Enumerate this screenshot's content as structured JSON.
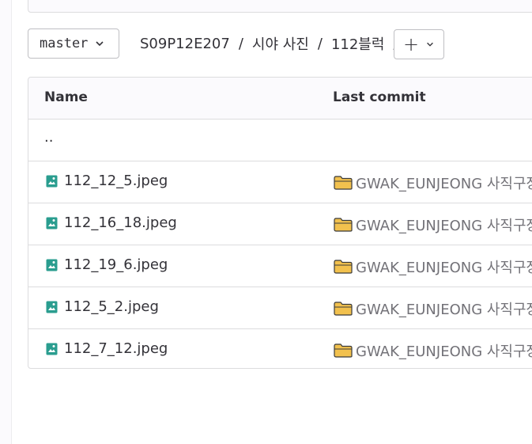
{
  "branch": {
    "label": "master"
  },
  "breadcrumb": [
    {
      "label": "S09P12E207"
    },
    {
      "label": "시야 사진"
    },
    {
      "label": "112블럭"
    }
  ],
  "breadcrumb_separator": "/",
  "add_button": {
    "label": "+"
  },
  "table": {
    "headers": {
      "name": "Name",
      "last_commit": "Last commit"
    },
    "parent_row": "..",
    "rows": [
      {
        "name": "112_12_5.jpeg",
        "commit": "GWAK_EUNJEONG 사직구장"
      },
      {
        "name": "112_16_18.jpeg",
        "commit": "GWAK_EUNJEONG 사직구장"
      },
      {
        "name": "112_19_6.jpeg",
        "commit": "GWAK_EUNJEONG 사직구장"
      },
      {
        "name": "112_5_2.jpeg",
        "commit": "GWAK_EUNJEONG 사직구장"
      },
      {
        "name": "112_7_12.jpeg",
        "commit": "GWAK_EUNJEONG 사직구장"
      }
    ]
  },
  "icons": {
    "file": "image-file-icon",
    "commit": "folder-icon"
  },
  "colors": {
    "file_icon": "#2a9d8f",
    "folder": "#f2c14e",
    "border": "#dcdcde"
  }
}
